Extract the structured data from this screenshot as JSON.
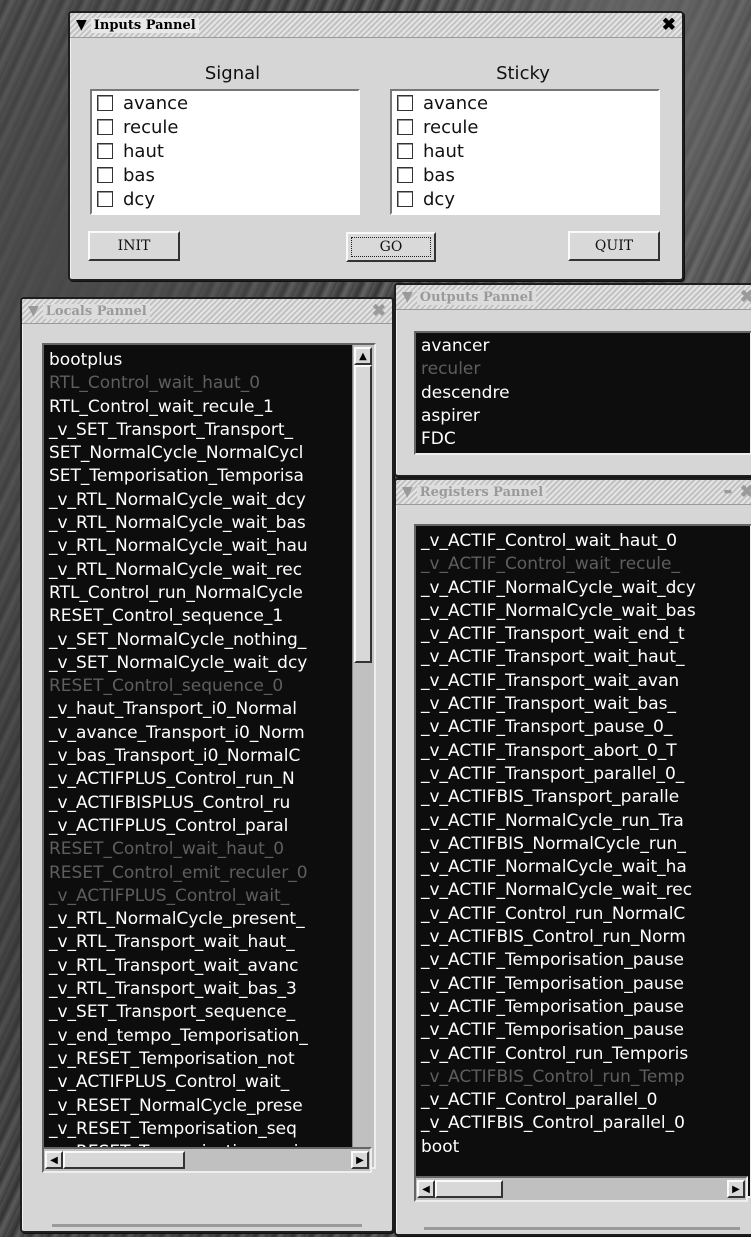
{
  "inputs_panel": {
    "title": "Inputs Pannel",
    "close_glyph": "✖",
    "signal_header": "Signal",
    "sticky_header": "Sticky",
    "signal_items": [
      "avance",
      "recule",
      "haut",
      "bas",
      "dcy"
    ],
    "sticky_items": [
      "avance",
      "recule",
      "haut",
      "bas",
      "dcy"
    ],
    "init_label": "INIT",
    "go_label": "GO",
    "quit_label": "QUIT"
  },
  "locals_panel": {
    "title": "Locals Pannel",
    "close_glyph": "✖",
    "items": [
      {
        "text": "bootplus",
        "dim": false
      },
      {
        "text": "RTL_Control_wait_haut_0",
        "dim": true
      },
      {
        "text": "RTL_Control_wait_recule_1",
        "dim": false
      },
      {
        "text": "_v_SET_Transport_Transport_",
        "dim": false
      },
      {
        "text": "SET_NormalCycle_NormalCycl",
        "dim": false
      },
      {
        "text": "SET_Temporisation_Temporisa",
        "dim": false
      },
      {
        "text": "_v_RTL_NormalCycle_wait_dcy",
        "dim": false
      },
      {
        "text": "_v_RTL_NormalCycle_wait_bas",
        "dim": false
      },
      {
        "text": "_v_RTL_NormalCycle_wait_hau",
        "dim": false
      },
      {
        "text": "_v_RTL_NormalCycle_wait_rec",
        "dim": false
      },
      {
        "text": "RTL_Control_run_NormalCycle",
        "dim": false
      },
      {
        "text": "RESET_Control_sequence_1",
        "dim": false
      },
      {
        "text": "_v_SET_NormalCycle_nothing_",
        "dim": false
      },
      {
        "text": "_v_SET_NormalCycle_wait_dcy",
        "dim": false
      },
      {
        "text": "RESET_Control_sequence_0",
        "dim": true
      },
      {
        "text": "_v_haut_Transport_i0_Normal",
        "dim": false
      },
      {
        "text": "_v_avance_Transport_i0_Norm",
        "dim": false
      },
      {
        "text": "_v_bas_Transport_i0_NormalC",
        "dim": false
      },
      {
        "text": "_v_ACTIFPLUS_Control_run_N",
        "dim": false
      },
      {
        "text": "_v_ACTIFBISPLUS_Control_ru",
        "dim": false
      },
      {
        "text": "_v_ACTIFPLUS_Control_paral",
        "dim": false
      },
      {
        "text": "RESET_Control_wait_haut_0",
        "dim": true
      },
      {
        "text": "RESET_Control_emit_reculer_0",
        "dim": true
      },
      {
        "text": "_v_ACTIFPLUS_Control_wait_",
        "dim": true
      },
      {
        "text": "_v_RTL_NormalCycle_present_",
        "dim": false
      },
      {
        "text": "_v_RTL_Transport_wait_haut_",
        "dim": false
      },
      {
        "text": "_v_RTL_Transport_wait_avanc",
        "dim": false
      },
      {
        "text": "_v_RTL_Transport_wait_bas_3",
        "dim": false
      },
      {
        "text": "_v_SET_Transport_sequence_",
        "dim": false
      },
      {
        "text": "_v_end_tempo_Temporisation_",
        "dim": false
      },
      {
        "text": "_v_RESET_Temporisation_not",
        "dim": false
      },
      {
        "text": "_v_ACTIFPLUS_Control_wait_",
        "dim": false
      },
      {
        "text": "_v_RESET_NormalCycle_prese",
        "dim": false
      },
      {
        "text": "_v_RESET_Temporisation_seq",
        "dim": false
      },
      {
        "text": "_v_RESET_Temporisation_emi",
        "dim": false
      }
    ]
  },
  "outputs_panel": {
    "title": "Outputs Pannel",
    "close_glyph": "✖",
    "items": [
      {
        "text": "avancer",
        "dim": false
      },
      {
        "text": "reculer",
        "dim": true
      },
      {
        "text": "descendre",
        "dim": false
      },
      {
        "text": "aspirer",
        "dim": false
      },
      {
        "text": "FDC",
        "dim": false
      }
    ]
  },
  "registers_panel": {
    "title": "Registers Pannel",
    "minimize_glyph": "▬",
    "close_glyph": "✖",
    "items": [
      {
        "text": "_v_ACTIF_Control_wait_haut_0",
        "dim": false
      },
      {
        "text": "_v_ACTIF_Control_wait_recule_",
        "dim": true
      },
      {
        "text": "_v_ACTIF_NormalCycle_wait_dcy",
        "dim": false
      },
      {
        "text": "_v_ACTIF_NormalCycle_wait_bas",
        "dim": false
      },
      {
        "text": "_v_ACTIF_Transport_wait_end_t",
        "dim": false
      },
      {
        "text": "_v_ACTIF_Transport_wait_haut_",
        "dim": false
      },
      {
        "text": "_v_ACTIF_Transport_wait_avan",
        "dim": false
      },
      {
        "text": "_v_ACTIF_Transport_wait_bas_",
        "dim": false
      },
      {
        "text": "_v_ACTIF_Transport_pause_0_",
        "dim": false
      },
      {
        "text": "_v_ACTIF_Transport_abort_0_T",
        "dim": false
      },
      {
        "text": "_v_ACTIF_Transport_parallel_0_",
        "dim": false
      },
      {
        "text": "_v_ACTIFBIS_Transport_paralle",
        "dim": false
      },
      {
        "text": "_v_ACTIF_NormalCycle_run_Tra",
        "dim": false
      },
      {
        "text": "_v_ACTIFBIS_NormalCycle_run_",
        "dim": false
      },
      {
        "text": "_v_ACTIF_NormalCycle_wait_ha",
        "dim": false
      },
      {
        "text": "_v_ACTIF_NormalCycle_wait_rec",
        "dim": false
      },
      {
        "text": "_v_ACTIF_Control_run_NormalC",
        "dim": false
      },
      {
        "text": "_v_ACTIFBIS_Control_run_Norm",
        "dim": false
      },
      {
        "text": "_v_ACTIF_Temporisation_pause",
        "dim": false
      },
      {
        "text": "_v_ACTIF_Temporisation_pause",
        "dim": false
      },
      {
        "text": "_v_ACTIF_Temporisation_pause",
        "dim": false
      },
      {
        "text": "_v_ACTIF_Temporisation_pause",
        "dim": false
      },
      {
        "text": "_v_ACTIF_Control_run_Temporis",
        "dim": false
      },
      {
        "text": "_v_ACTIFBIS_Control_run_Temp",
        "dim": true
      },
      {
        "text": "_v_ACTIF_Control_parallel_0",
        "dim": false
      },
      {
        "text": "_v_ACTIFBIS_Control_parallel_0",
        "dim": false
      },
      {
        "text": "boot",
        "dim": false
      }
    ]
  },
  "scroll_glyphs": {
    "up": "▲",
    "down": "▼",
    "left": "◀",
    "right": "▶"
  }
}
